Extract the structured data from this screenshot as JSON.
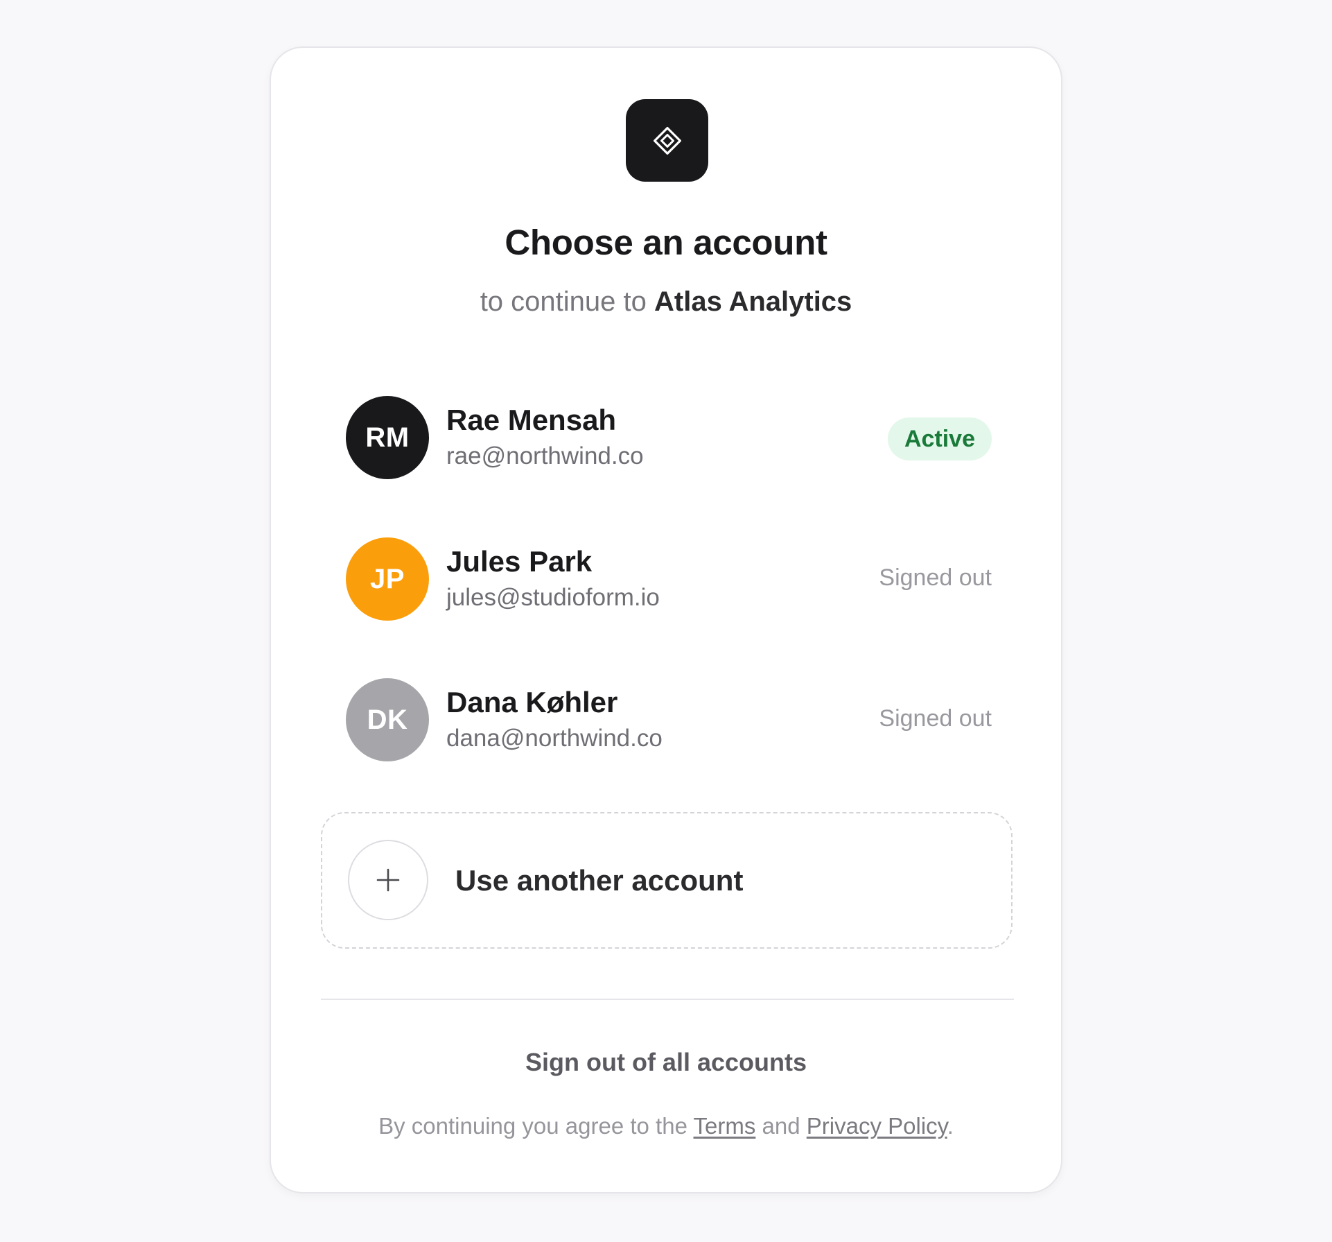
{
  "header": {
    "logo_icon": "diamond-icon",
    "title": "Choose an account",
    "subtitle_prefix": "to continue to",
    "app_name": "Atlas Analytics"
  },
  "accounts": [
    {
      "initials": "RM",
      "name": "Rae Mensah",
      "email": "rae@northwind.co",
      "status": "Active",
      "avatar_color": "#19191b"
    },
    {
      "initials": "JP",
      "name": "Jules Park",
      "email": "jules@studioform.io",
      "status": "Signed out",
      "avatar_color": "#fb9e0c"
    },
    {
      "initials": "DK",
      "name": "Dana Køhler",
      "email": "dana@northwind.co",
      "status": "Signed out",
      "avatar_color": "#a6a5aa"
    }
  ],
  "another_account": {
    "icon": "plus-icon",
    "label": "Use another account"
  },
  "footer": {
    "sign_out_all": "Sign out of all accounts",
    "legal_prefix": "By continuing you agree to the",
    "terms": "Terms",
    "and": "and",
    "privacy": "Privacy Policy",
    "period": "."
  },
  "colors": {
    "page_background": "#f8f7f9",
    "card_background": "#ffffff",
    "active_badge_bg": "#e3f7ea",
    "active_badge_text": "#1a7a3a"
  }
}
